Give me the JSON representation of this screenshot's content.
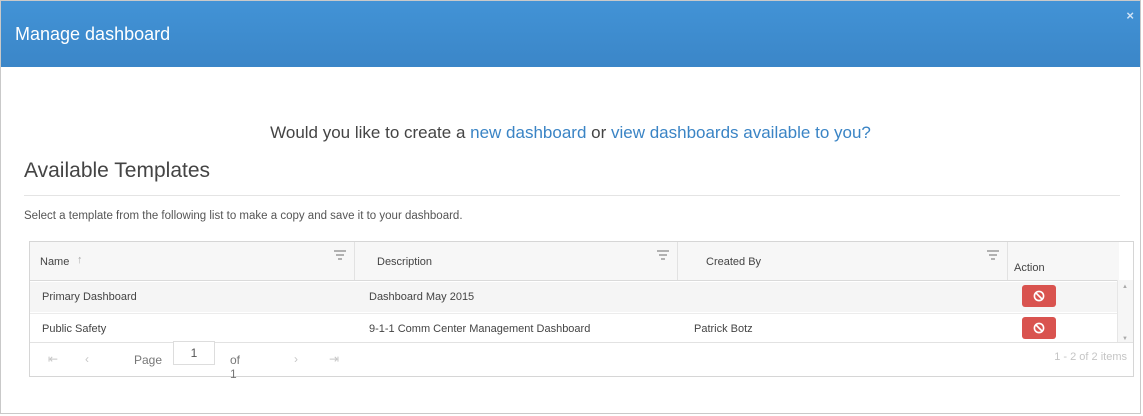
{
  "dialog": {
    "title": "Manage dashboard",
    "close_label": "×"
  },
  "question": {
    "prefix": "Would you like to create a ",
    "new_link": "new dashboard",
    "middle": " or ",
    "view_link": "view dashboards available to you?"
  },
  "section": {
    "title": "Available Templates",
    "hint": "Select a template from the following list to make a copy and save it to your dashboard."
  },
  "grid": {
    "columns": {
      "name": "Name",
      "name_sort": "↑",
      "description": "Description",
      "created_by": "Created By",
      "action": "Action"
    },
    "rows": [
      {
        "name": "Primary Dashboard",
        "description": "Dashboard May 2015",
        "created_by": ""
      },
      {
        "name": "Public Safety",
        "description": "9-1-1 Comm Center Management Dashboard",
        "created_by": "Patrick Botz"
      }
    ],
    "pager": {
      "first": "⇤",
      "prev": "‹",
      "page_label": "Page",
      "page_value": "1",
      "of_label": "of 1",
      "next": "›",
      "last": "⇥",
      "items_info": "1 - 2 of 2 items"
    }
  },
  "colors": {
    "header_bg": "#3f8dd0",
    "link": "#3a84c5",
    "delete_button": "#d9534f"
  },
  "icons": {
    "filter": "filter-icon",
    "delete": "delete-icon"
  }
}
